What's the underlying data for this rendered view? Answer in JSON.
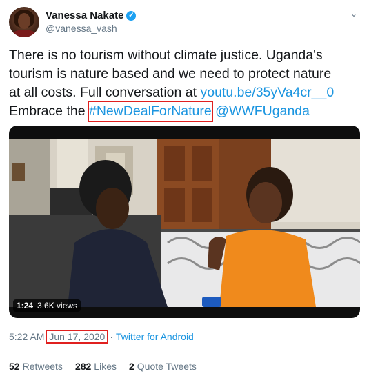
{
  "author": {
    "name": "Vanessa Nakate",
    "handle": "@vanessa_vash",
    "verified_icon": "verified-badge-icon"
  },
  "tweet": {
    "line1": "There is no tourism without climate justice. Uganda's",
    "line2": "tourism is nature based and we need to protect nature",
    "line3_text": "at all costs. Full conversation at ",
    "link": "youtu.be/35yVa4cr__0",
    "line4_text": "Embrace the ",
    "hashtag": "#NewDealForNature",
    "mention": "@WWFUganda"
  },
  "video": {
    "duration": "1:24",
    "views": "3.6K views"
  },
  "meta": {
    "time": "5:22 AM",
    "separator": "·",
    "date": "Jun 17, 2020",
    "source": "Twitter for Android"
  },
  "stats": {
    "retweets_count": "52",
    "retweets_label": "Retweets",
    "likes_count": "282",
    "likes_label": "Likes",
    "quotes_count": "2",
    "quotes_label": "Quote Tweets"
  },
  "colors": {
    "link": "#1b95e0",
    "highlight_box": "#e0201f",
    "verified": "#1da1f2"
  }
}
